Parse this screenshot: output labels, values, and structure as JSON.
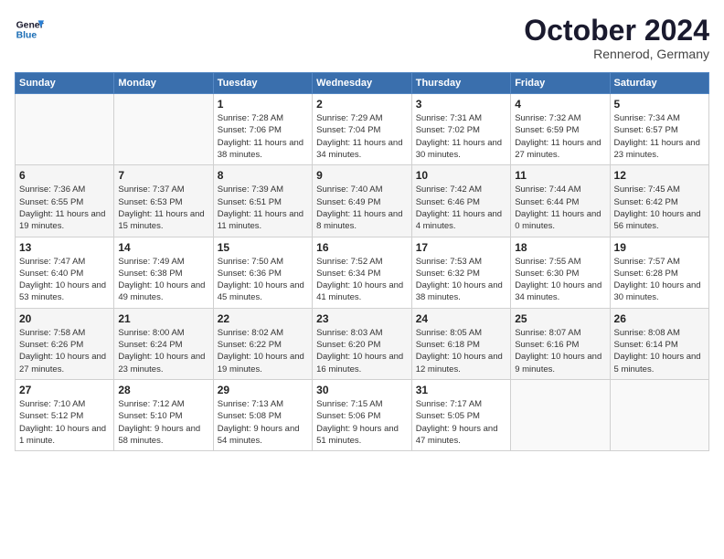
{
  "logo": {
    "line1": "General",
    "line2": "Blue"
  },
  "title": "October 2024",
  "location": "Rennerod, Germany",
  "weekdays": [
    "Sunday",
    "Monday",
    "Tuesday",
    "Wednesday",
    "Thursday",
    "Friday",
    "Saturday"
  ],
  "weeks": [
    [
      {
        "day": "",
        "info": ""
      },
      {
        "day": "",
        "info": ""
      },
      {
        "day": "1",
        "info": "Sunrise: 7:28 AM\nSunset: 7:06 PM\nDaylight: 11 hours and 38 minutes."
      },
      {
        "day": "2",
        "info": "Sunrise: 7:29 AM\nSunset: 7:04 PM\nDaylight: 11 hours and 34 minutes."
      },
      {
        "day": "3",
        "info": "Sunrise: 7:31 AM\nSunset: 7:02 PM\nDaylight: 11 hours and 30 minutes."
      },
      {
        "day": "4",
        "info": "Sunrise: 7:32 AM\nSunset: 6:59 PM\nDaylight: 11 hours and 27 minutes."
      },
      {
        "day": "5",
        "info": "Sunrise: 7:34 AM\nSunset: 6:57 PM\nDaylight: 11 hours and 23 minutes."
      }
    ],
    [
      {
        "day": "6",
        "info": "Sunrise: 7:36 AM\nSunset: 6:55 PM\nDaylight: 11 hours and 19 minutes."
      },
      {
        "day": "7",
        "info": "Sunrise: 7:37 AM\nSunset: 6:53 PM\nDaylight: 11 hours and 15 minutes."
      },
      {
        "day": "8",
        "info": "Sunrise: 7:39 AM\nSunset: 6:51 PM\nDaylight: 11 hours and 11 minutes."
      },
      {
        "day": "9",
        "info": "Sunrise: 7:40 AM\nSunset: 6:49 PM\nDaylight: 11 hours and 8 minutes."
      },
      {
        "day": "10",
        "info": "Sunrise: 7:42 AM\nSunset: 6:46 PM\nDaylight: 11 hours and 4 minutes."
      },
      {
        "day": "11",
        "info": "Sunrise: 7:44 AM\nSunset: 6:44 PM\nDaylight: 11 hours and 0 minutes."
      },
      {
        "day": "12",
        "info": "Sunrise: 7:45 AM\nSunset: 6:42 PM\nDaylight: 10 hours and 56 minutes."
      }
    ],
    [
      {
        "day": "13",
        "info": "Sunrise: 7:47 AM\nSunset: 6:40 PM\nDaylight: 10 hours and 53 minutes."
      },
      {
        "day": "14",
        "info": "Sunrise: 7:49 AM\nSunset: 6:38 PM\nDaylight: 10 hours and 49 minutes."
      },
      {
        "day": "15",
        "info": "Sunrise: 7:50 AM\nSunset: 6:36 PM\nDaylight: 10 hours and 45 minutes."
      },
      {
        "day": "16",
        "info": "Sunrise: 7:52 AM\nSunset: 6:34 PM\nDaylight: 10 hours and 41 minutes."
      },
      {
        "day": "17",
        "info": "Sunrise: 7:53 AM\nSunset: 6:32 PM\nDaylight: 10 hours and 38 minutes."
      },
      {
        "day": "18",
        "info": "Sunrise: 7:55 AM\nSunset: 6:30 PM\nDaylight: 10 hours and 34 minutes."
      },
      {
        "day": "19",
        "info": "Sunrise: 7:57 AM\nSunset: 6:28 PM\nDaylight: 10 hours and 30 minutes."
      }
    ],
    [
      {
        "day": "20",
        "info": "Sunrise: 7:58 AM\nSunset: 6:26 PM\nDaylight: 10 hours and 27 minutes."
      },
      {
        "day": "21",
        "info": "Sunrise: 8:00 AM\nSunset: 6:24 PM\nDaylight: 10 hours and 23 minutes."
      },
      {
        "day": "22",
        "info": "Sunrise: 8:02 AM\nSunset: 6:22 PM\nDaylight: 10 hours and 19 minutes."
      },
      {
        "day": "23",
        "info": "Sunrise: 8:03 AM\nSunset: 6:20 PM\nDaylight: 10 hours and 16 minutes."
      },
      {
        "day": "24",
        "info": "Sunrise: 8:05 AM\nSunset: 6:18 PM\nDaylight: 10 hours and 12 minutes."
      },
      {
        "day": "25",
        "info": "Sunrise: 8:07 AM\nSunset: 6:16 PM\nDaylight: 10 hours and 9 minutes."
      },
      {
        "day": "26",
        "info": "Sunrise: 8:08 AM\nSunset: 6:14 PM\nDaylight: 10 hours and 5 minutes."
      }
    ],
    [
      {
        "day": "27",
        "info": "Sunrise: 7:10 AM\nSunset: 5:12 PM\nDaylight: 10 hours and 1 minute."
      },
      {
        "day": "28",
        "info": "Sunrise: 7:12 AM\nSunset: 5:10 PM\nDaylight: 9 hours and 58 minutes."
      },
      {
        "day": "29",
        "info": "Sunrise: 7:13 AM\nSunset: 5:08 PM\nDaylight: 9 hours and 54 minutes."
      },
      {
        "day": "30",
        "info": "Sunrise: 7:15 AM\nSunset: 5:06 PM\nDaylight: 9 hours and 51 minutes."
      },
      {
        "day": "31",
        "info": "Sunrise: 7:17 AM\nSunset: 5:05 PM\nDaylight: 9 hours and 47 minutes."
      },
      {
        "day": "",
        "info": ""
      },
      {
        "day": "",
        "info": ""
      }
    ]
  ]
}
